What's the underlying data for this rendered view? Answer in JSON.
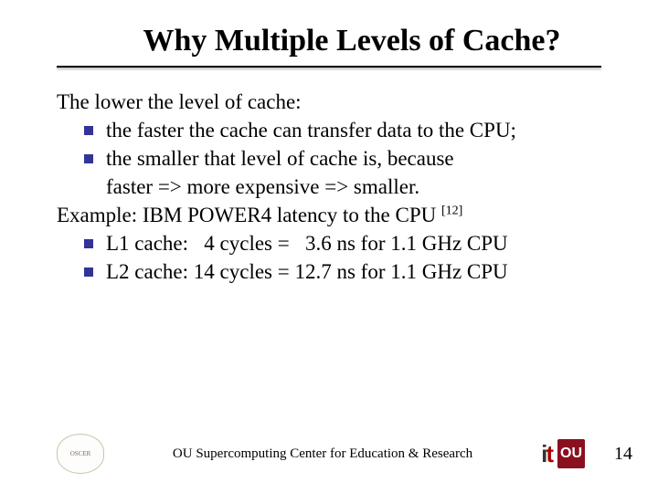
{
  "title": "Why Multiple Levels of Cache?",
  "body": {
    "intro": "The lower the level of cache:",
    "bullets_a": [
      "the faster the cache can transfer data to the CPU;",
      "the smaller that level of cache is, because"
    ],
    "cont": "faster => more expensive => smaller.",
    "example_prefix": "Example: IBM POWER4 latency to the CPU ",
    "example_cite": "[12]",
    "bullets_b": [
      "L1 cache:   4 cycles =   3.6 ns for 1.1 GHz CPU",
      "L2 cache: 14 cycles = 12.7 ns for 1.1 GHz CPU"
    ]
  },
  "footer": {
    "text": "OU Supercomputing Center for Education & Research",
    "page": "14",
    "left_logo_alt": "OSCER",
    "ou_text": "OU"
  }
}
